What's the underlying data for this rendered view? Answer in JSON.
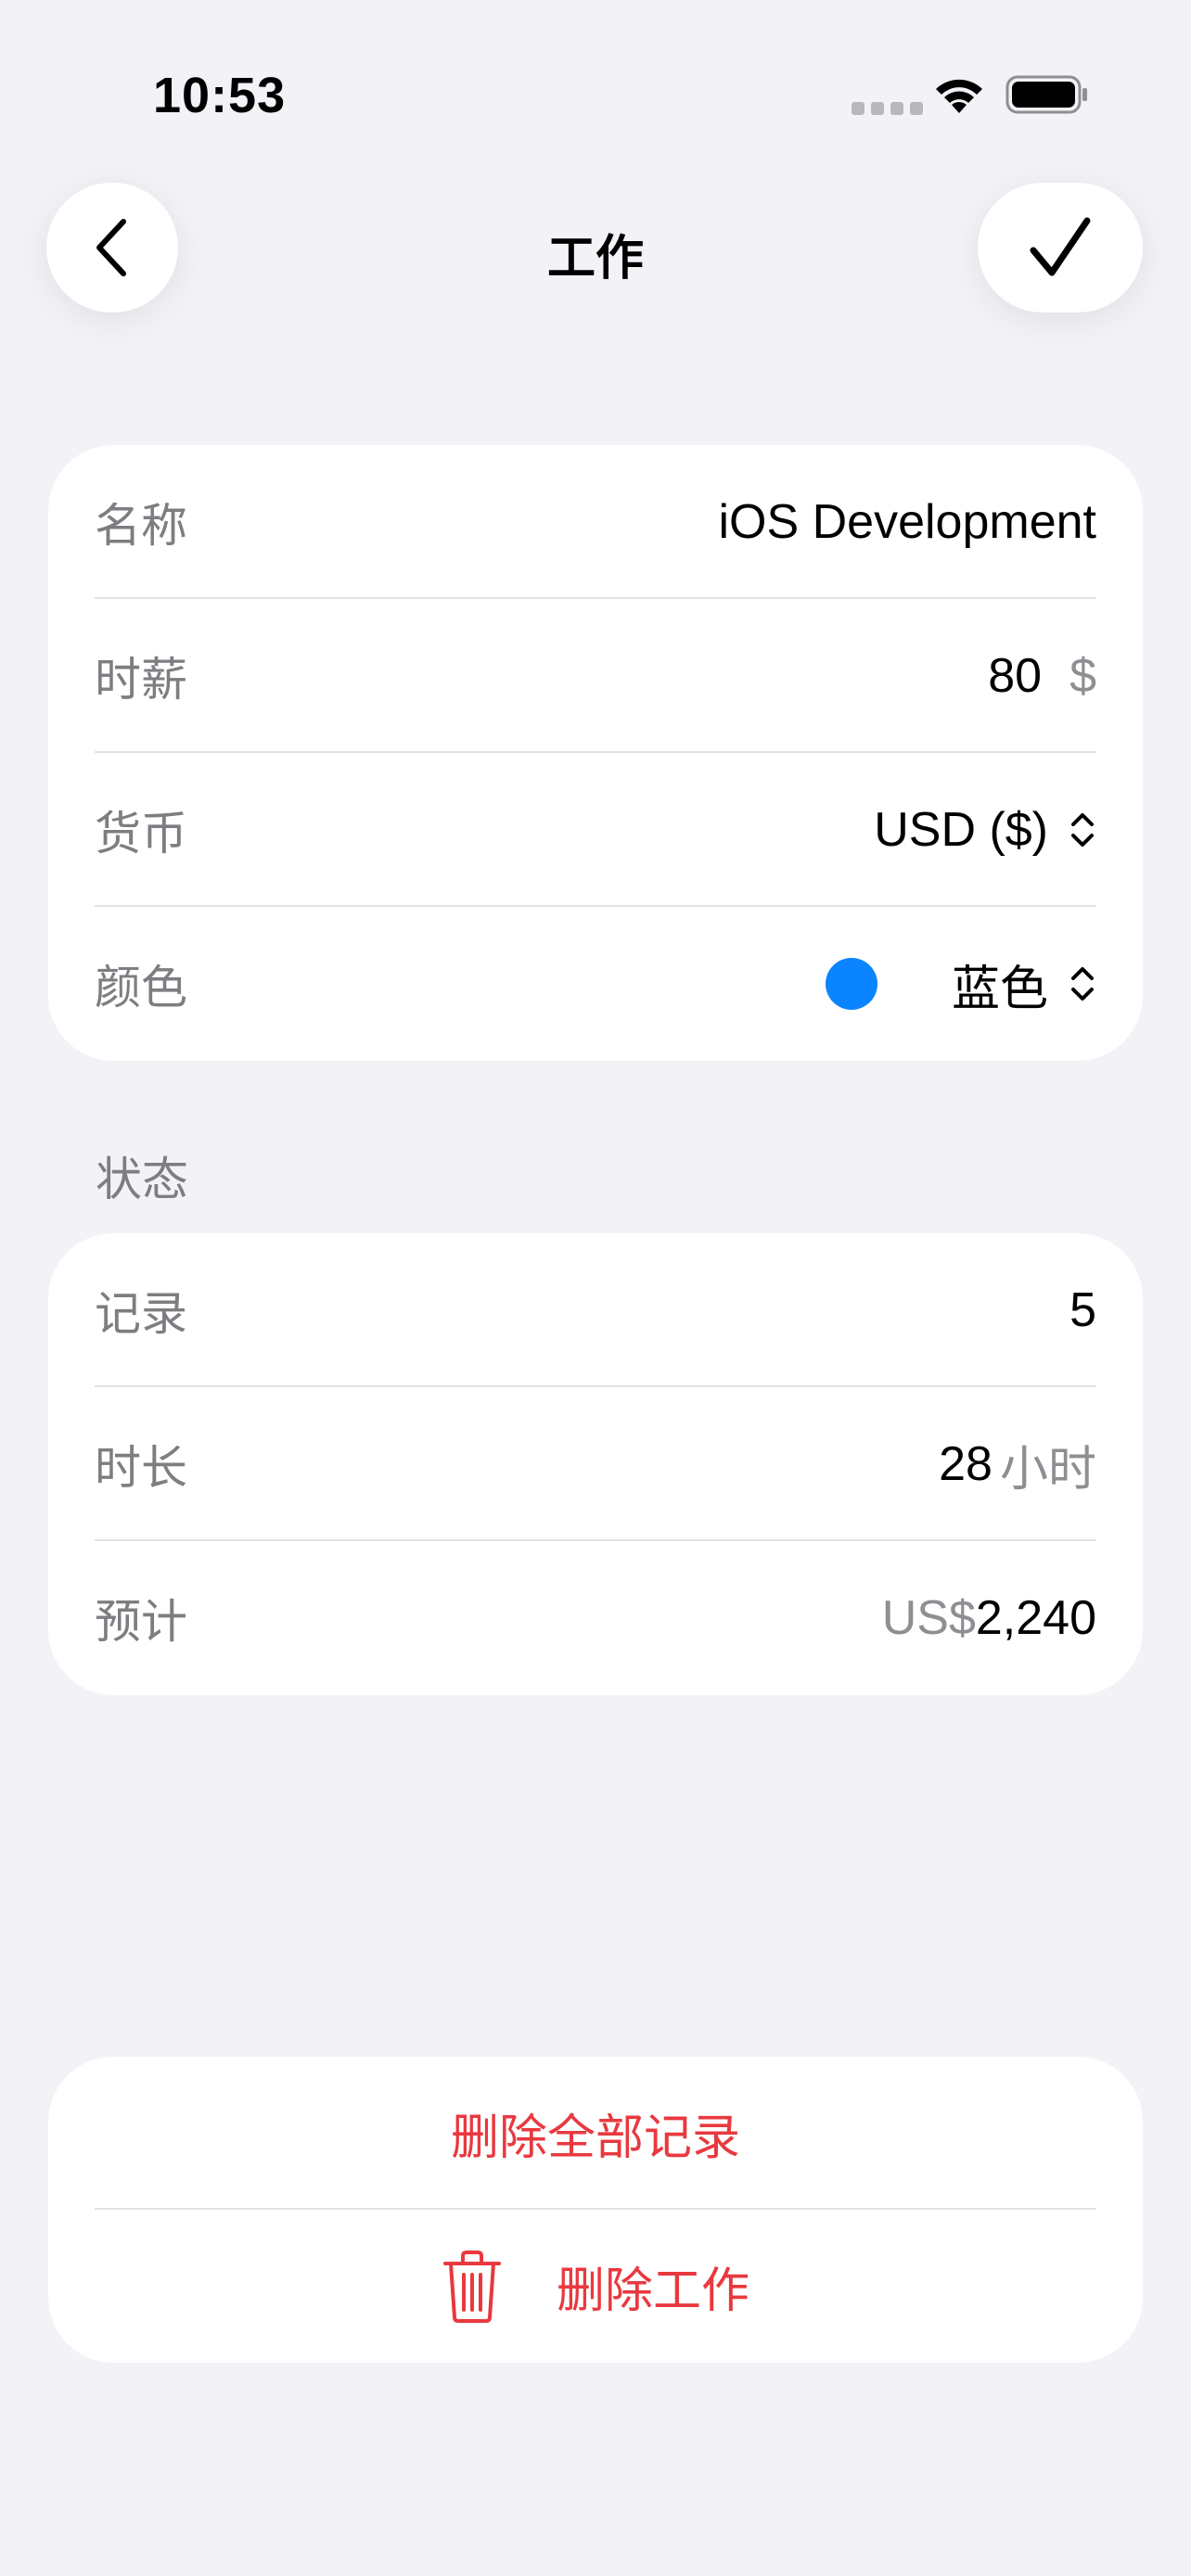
{
  "status_bar": {
    "time": "10:53"
  },
  "nav": {
    "title": "工作"
  },
  "job": {
    "name_label": "名称",
    "name_value": "iOS Development",
    "rate_label": "时薪",
    "rate_value": "80",
    "rate_unit": "$",
    "currency_label": "货币",
    "currency_value": "USD ($)",
    "color_label": "颜色",
    "color_value": "蓝色",
    "color_hex": "#0a84ff"
  },
  "stats": {
    "header": "状态",
    "records_label": "记录",
    "records_value": "5",
    "duration_label": "时长",
    "duration_value": "28",
    "duration_unit": "小时",
    "estimate_label": "预计",
    "estimate_prefix": "US$",
    "estimate_value": "2,240"
  },
  "actions": {
    "delete_records": "删除全部记录",
    "delete_job": "删除工作"
  },
  "colors": {
    "background": "#f2f2f7",
    "danger": "#e8393f",
    "accent": "#0a84ff"
  }
}
